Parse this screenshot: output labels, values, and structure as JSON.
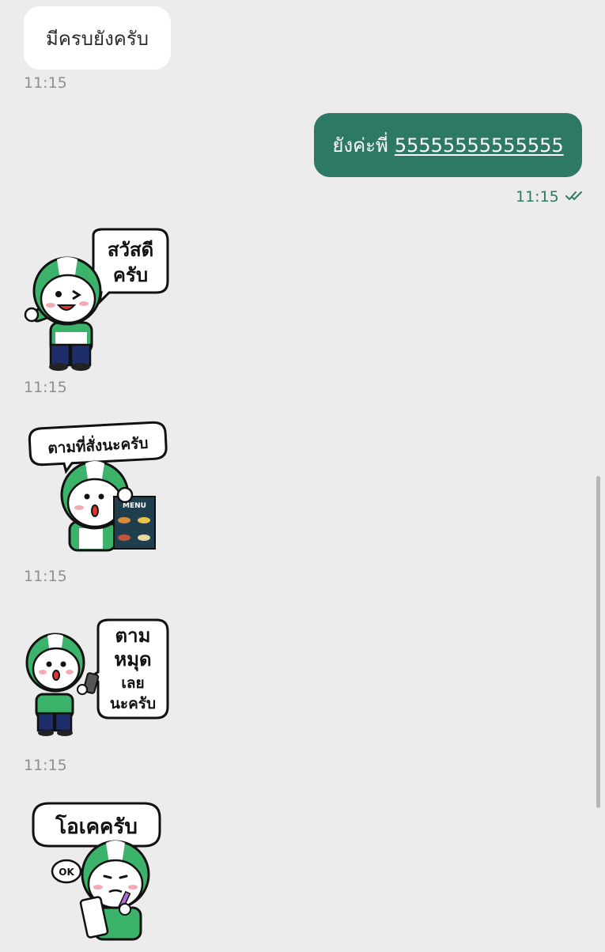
{
  "messages": [
    {
      "type": "text",
      "side": "incoming",
      "text": "มีครบยังครับ",
      "time": "11:15"
    },
    {
      "type": "text",
      "side": "outgoing",
      "text_prefix": "ยังค่ะพี่",
      "text_link": "55555555555555",
      "time": "11:15",
      "status": "read"
    },
    {
      "type": "sticker",
      "side": "incoming",
      "lines": [
        "สวัสดี",
        "ครับ"
      ],
      "time": "11:15"
    },
    {
      "type": "sticker",
      "side": "incoming",
      "lines": [
        "ตามที่สั่งนะครับ"
      ],
      "menu_label": "MENU",
      "time": "11:15"
    },
    {
      "type": "sticker",
      "side": "incoming",
      "lines": [
        "ตาม",
        "หมุด",
        "เลย",
        "นะครับ"
      ],
      "time": "11:15"
    },
    {
      "type": "sticker",
      "side": "incoming",
      "lines": [
        "โอเคครับ"
      ],
      "ok_label": "OK"
    }
  ],
  "colors": {
    "background": "#ececec",
    "incoming_bubble": "#ffffff",
    "outgoing_bubble": "#2e7866",
    "helmet_green": "#3cb36a",
    "time_gray": "#8f8f8f"
  },
  "icons": {
    "read_receipt": "double-check-icon"
  }
}
